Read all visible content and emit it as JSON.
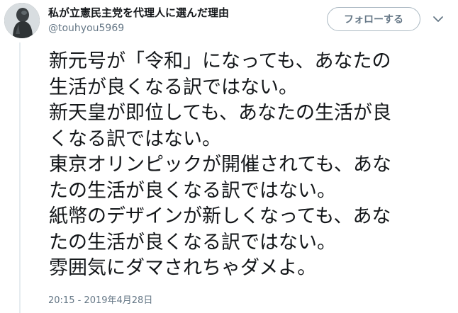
{
  "user": {
    "display_name": "私が立憲民主党を代理人に選んだ理由",
    "screen_name": "@touhyou5969",
    "avatar_icon": "statue-avatar-icon"
  },
  "actions": {
    "follow_label": "フォローする",
    "more_icon": "chevron-down-icon"
  },
  "tweet": {
    "lines": [
      "新元号が「令和」になっても、あなたの",
      "生活が良くなる訳ではない。",
      "新天皇が即位しても、あなたの生活が良",
      "くなる訳ではない。",
      "東京オリンピックが開催されても、あな",
      "たの生活が良くなる訳ではない。",
      "紙幣のデザインが新しくなっても、あな",
      "たの生活が良くなる訳ではない。",
      "雰囲気にダマされちゃダメよ。"
    ],
    "timestamp": "20:15 - 2019年4月28日"
  },
  "colors": {
    "text": "#14171a",
    "secondary": "#657786",
    "border": "#aab8c2"
  }
}
